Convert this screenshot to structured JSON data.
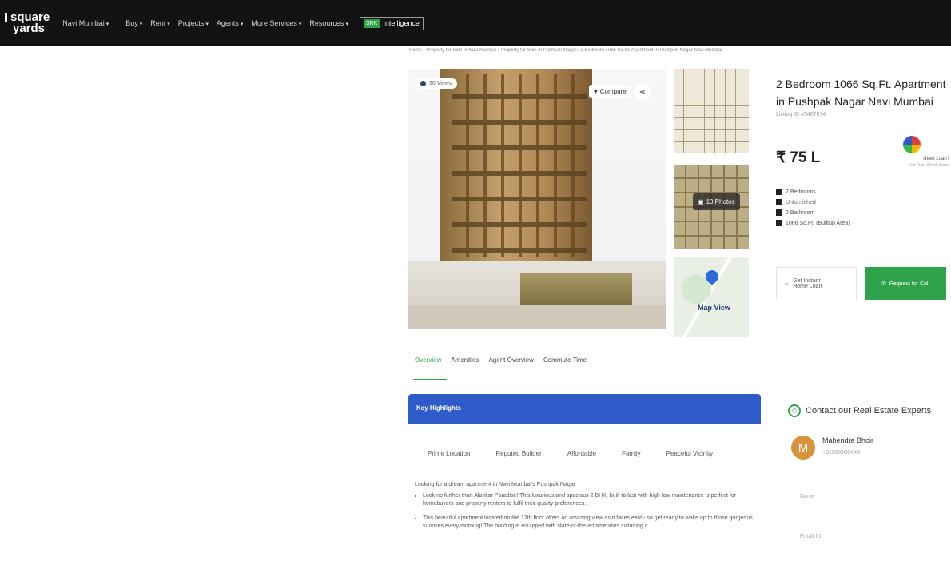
{
  "brand": {
    "line1": "square",
    "line2": "yards"
  },
  "nav": {
    "items": [
      {
        "label": "Navi Mumbai"
      },
      {
        "label": "Buy"
      },
      {
        "label": "Rent"
      },
      {
        "label": "Projects"
      },
      {
        "label": "Agents"
      },
      {
        "label": "More Services"
      },
      {
        "label": "Resources"
      }
    ],
    "intel_badge": "SRK",
    "intel_label": "Intelligence"
  },
  "breadcrumb": "Home › Property for Sale in Navi Mumbai › Property for Sale in Pushpak Nagar › 2 Bedroom 1066 Sq.Ft. Apartment in Pushpak Nagar Navi Mumbai",
  "gallery": {
    "views_label": "30 Views",
    "compare_label": "Compare",
    "photos_label": "10 Photos",
    "map_label": "Map View"
  },
  "tabs": [
    "Overview",
    "Amenities",
    "Agent Overview",
    "Commute Time"
  ],
  "key_highlights": {
    "title": "Key Highlights",
    "chips": [
      "Prime Location",
      "Reputed Builder",
      "Affordable",
      "Family",
      "Peaceful Vicinity"
    ]
  },
  "description": {
    "intro": "Looking for a dream apartment in Navi Mumbai's Pushpak Nagar",
    "bullets": [
      "Look no further than Alankar Paradise! This luxurious and spacious 2 BHK, built to last with high-low maintenance is perfect for homebuyers and property renters to fulfil their quality preferences.",
      "This beautiful apartment located on the 12th floor offers an amazing view as it faces east - so get ready to wake up to those gorgeous sunrises every morning! The building is equipped with state-of-the-art amenities including a"
    ]
  },
  "listing": {
    "title": "2 Bedroom 1066 Sq.Ft. Apartment in Pushpak Nagar Navi Mumbai",
    "listing_id": "Listing ID #5407874",
    "price": "₹ 75 L",
    "gauge_label": "Need Loan?",
    "gauge_sub": "Get Price Check Score",
    "specs": [
      {
        "icon": "bed-icon",
        "label": "2 Bedrooms"
      },
      {
        "icon": "sofa-icon",
        "label": "Unfurnished"
      },
      {
        "icon": "bathtub-icon",
        "label": "2 Bathroom"
      },
      {
        "icon": "home-icon",
        "label": "1066 Sq.Ft. (Builtup Area)"
      }
    ],
    "loan_label_1": "Get Instant",
    "loan_label_2": "Home Loan",
    "call_label": "Request for Call"
  },
  "contact": {
    "heading": "Contact our Real Estate Experts",
    "agent_initial": "M",
    "agent_name": "Mahendra Bhoir",
    "agent_phone": "+9180XXXXXX",
    "name_placeholder": "Name",
    "email_placeholder": "Email ID"
  },
  "colors": {
    "topbar": "#121212",
    "accent_green": "#2ea34b",
    "highlights_blue": "#2f5bc9",
    "agent_avatar": "#d9933a"
  }
}
